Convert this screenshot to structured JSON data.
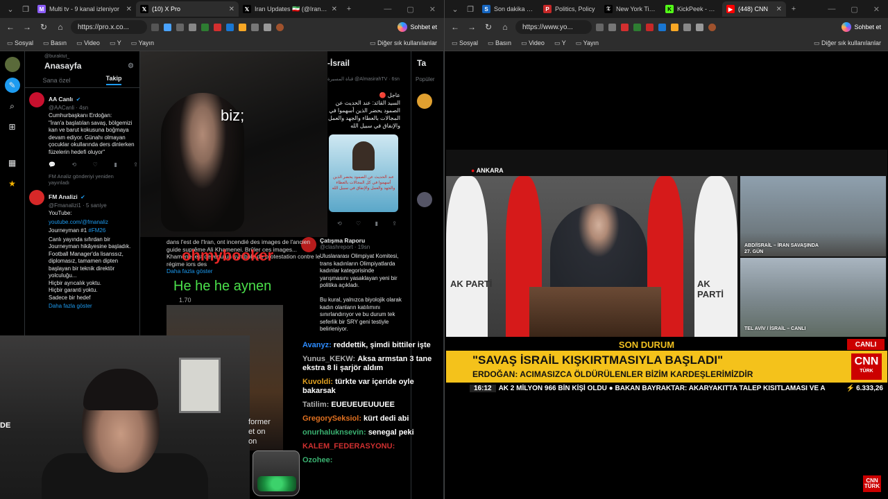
{
  "left": {
    "tabs": [
      {
        "title": "Multi tv - 9 kanal izleniyor",
        "fav": "M",
        "color": "#8b5cf6",
        "active": false
      },
      {
        "title": "(10) X Pro",
        "fav": "X",
        "color": "#000000",
        "active": true
      },
      {
        "title": "Iran Updates 🇮🇷 (@IranUpdate",
        "fav": "X",
        "color": "#000000",
        "active": false
      }
    ],
    "url": "https://pro.x.co...",
    "sohbet": "Sohbet et",
    "bookmarks": [
      "Sosyal",
      "Basın",
      "Video",
      "Y",
      "Yayın"
    ],
    "bookmarks_right": "Diğer sık kullanılanlar",
    "col1": {
      "pretitle": "@buraktut_",
      "title": "Anasayfa",
      "tabs": [
        "Sana özel",
        "Takip"
      ],
      "tweets": [
        {
          "name": "AA Canlı",
          "handle": "@AACanli · 4sn",
          "avatar_color": "#c8102e",
          "avatar_text": "aa",
          "body": "Cumhurbaşkanı Erdoğan:\n\"İran'a başlatılan savaş, bölgemizi kan ve barut kokusuna boğmaya devam ediyor. Günahı olmayan çocuklar okullarında ders dinlerken füzelerin hedefi oluyor\"",
          "link": ""
        },
        {
          "name": "FM Analizi",
          "handle": "@Fmanalizi1 · 5 saniye",
          "avatar_color": "#d62828",
          "avatar_text": "FM",
          "retweet": "FM Analiz gönderiyi yeniden yayınladı",
          "body": "YouTube:",
          "link": "youtube.com/@fmanaliz",
          "body2": "Journeyman #1",
          "hashtag": "#FM26",
          "body3": "Canlı yayında sıfırdan bir Journeyman hikâyesine başladık.\nFootball Manager'da lisanssız, diplomasız, tamamen dipten başlayan bir teknik direktör yolculuğu...\nHiçbir ayrıcalık yoktu.\nHiçbir garanti yoktu.\nSadece bir hedef",
          "more": "Daha fazla göster"
        }
      ]
    },
    "col3": {
      "title": "-İsrail",
      "handle": "قناة المسيرة @AlmasirahTV · 6sn",
      "arabic": "عاجل 🔴\nالسيد القائد: عند الحديث عن الصمود يحضر الذين أسهموا في المجالات بالعطاء والجهد والعمل والإنفاق في سبيل الله",
      "card_text": "عند الحديث عن الصمود يحضر الذين أسهموا في كل المجالات بالعطاء والجهد والعمل والإنفاق في سبيل الله",
      "tweet2_name": "Çatışma Raporu",
      "tweet2_handle": "@clashreport · 19sn",
      "tweet2_body": "Uluslararası Olimpiyat Komitesi, trans kadınların Olimpiyatlarda kadınlar kategorisinde yarışmasını yasaklayan yeni bir politika açıkladı.\n\nBu kural, yalnızca biyolojik olarak kadın olanların katılımını sınırlandırıyor ve bu durum tek seferlik bir SRY geni testiyle belirleniyor."
    },
    "col4": {
      "title": "Ta",
      "tab": "Popüler"
    },
    "mid_text": "dans l'est de l'Iran, ont incendié des images de l'ancien guide suprême Ali Khamenei. Brûler ces images... Khamenei est devenu un symbole de protestation contre le régime iors des",
    "mid_more": "Daha fazla göster",
    "mid_num": "1.70",
    "overlay_red": "ohmybooker",
    "overlay_green": "He he he aynen",
    "caption": "biz;",
    "former": "former\net on\non",
    "cam_label": "DE",
    "chat": [
      {
        "user": "Avanyz:",
        "color": "#2d8cff",
        "text": "reddettik, şimdi bittiler işte"
      },
      {
        "user": "Yunus_KEKW:",
        "color": "#b0b0b0",
        "text": "Aksa armstan 3 tane ekstra 8 li şarjör aldım"
      },
      {
        "user": "Kuvoldi:",
        "color": "#e0a020",
        "text": "türkte var içeride oyle bakarsak"
      },
      {
        "user": "Tatilim:",
        "color": "#b0b0b0",
        "text": "EUEUEUEUUUEE"
      },
      {
        "user": "GregorySeksiol:",
        "color": "#e07020",
        "text": "kürt dedi abi"
      },
      {
        "user": "onurhaluknsevin:",
        "color": "#3ab070",
        "text": "senegal peki"
      },
      {
        "user": "KALEM_FEDERASYONU:",
        "color": "#d03030",
        "text": ""
      },
      {
        "user": "Ozohee:",
        "color": "#3ab070",
        "text": ""
      }
    ]
  },
  "right": {
    "tabs": [
      {
        "title": "Son dakika haber",
        "fav": "S",
        "color": "#1565c0",
        "active": false
      },
      {
        "title": "Politics, Policy",
        "fav": "P",
        "color": "#c62828",
        "active": false
      },
      {
        "title": "New York Times",
        "fav": "T",
        "color": "#000000",
        "active": false
      },
      {
        "title": "KickPeek - Kick",
        "fav": "K",
        "color": "#53fc18",
        "active": false
      },
      {
        "title": "(448) CNN",
        "fav": "▶",
        "color": "#ff0000",
        "active": true
      }
    ],
    "url": "https://www.yo...",
    "sohbet": "Sohbet et",
    "bookmarks": [
      "Sosyal",
      "Basın",
      "Video",
      "Y",
      "Yayın"
    ],
    "bookmarks_right": "Diğer sık kullanılanlar",
    "location": "ANKARA",
    "akparti": "AK PARTİ",
    "side1": "ABD/İSRAİL – İRAN SAVAŞINDA\n27. GÜN",
    "side2": "TEL AVİV / İSRAİL – CANLI",
    "son_durum": "SON DURUM",
    "canli": "CANLI",
    "headline": "\"SAVAŞ İSRAİL KIŞKIRTMASIYLA BAŞLADI\"",
    "subheadline": "ERDOĞAN: ACIMASIZCA ÖLDÜRÜLENLER BİZİM KARDEŞLERİMİZDİR",
    "logo": "CNN",
    "logo_sub": "TÜRK",
    "ticker_time": "16:12",
    "ticker": "AK 2 MİLYON 966 BİN KİŞİ OLDU  ●  BAKAN BAYRAKTAR: AKARYAKITTA TALEP KISITLAMASI VE A",
    "index": "6.333,26",
    "bug": "CNN"
  }
}
